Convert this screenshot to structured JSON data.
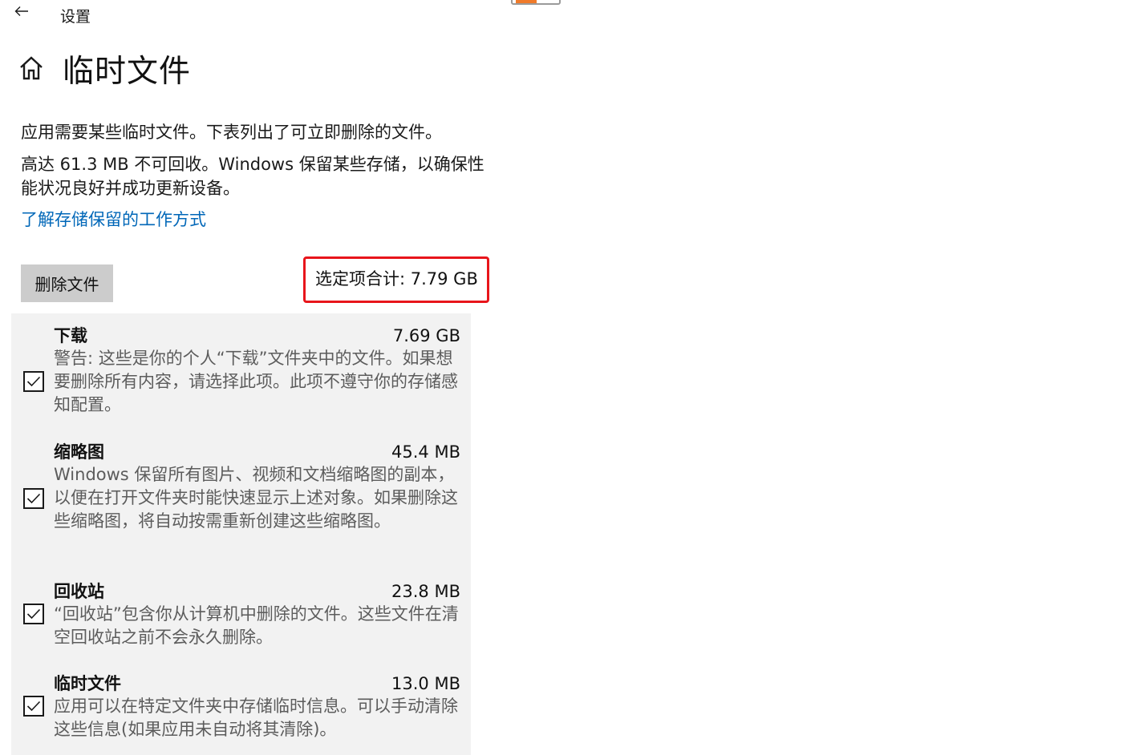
{
  "header": {
    "app_title": "设置",
    "page_title": "临时文件",
    "back_icon": "arrow-left-icon",
    "home_icon": "home-icon"
  },
  "description": {
    "line1": "应用需要某些临时文件。下表列出了可立即删除的文件。",
    "line2": "高达 61.3 MB 不可回收。Windows 保留某些存储，以确保性能状况良好并成功更新设备。",
    "learn_link": "了解存储保留的工作方式"
  },
  "actions": {
    "delete_label": "删除文件",
    "selected_total": "选定项合计: 7.79 GB"
  },
  "items": [
    {
      "name": "下载",
      "size": "7.69 GB",
      "description": "警告: 这些是你的个人“下载”文件夹中的文件。如果想要删除所有内容，请选择此项。此项不遵守你的存储感知配置。",
      "checked": true
    },
    {
      "name": "缩略图",
      "size": "45.4 MB",
      "description": "Windows 保留所有图片、视频和文档缩略图的副本，以便在打开文件夹时能快速显示上述对象。如果删除这些缩略图，将自动按需重新创建这些缩略图。",
      "checked": true
    },
    {
      "name": "回收站",
      "size": "23.8 MB",
      "description": "“回收站”包含你从计算机中删除的文件。这些文件在清空回收站之前不会永久删除。",
      "checked": true
    },
    {
      "name": "临时文件",
      "size": "13.0 MB",
      "description": "应用可以在特定文件夹中存储临时信息。可以手动清除这些信息(如果应用未自动将其清除)。",
      "checked": true
    }
  ],
  "colors": {
    "link": "#0067b8",
    "highlight_border": "#e8151b",
    "panel_bg": "#f2f2f2",
    "button_bg": "#cccccc"
  }
}
